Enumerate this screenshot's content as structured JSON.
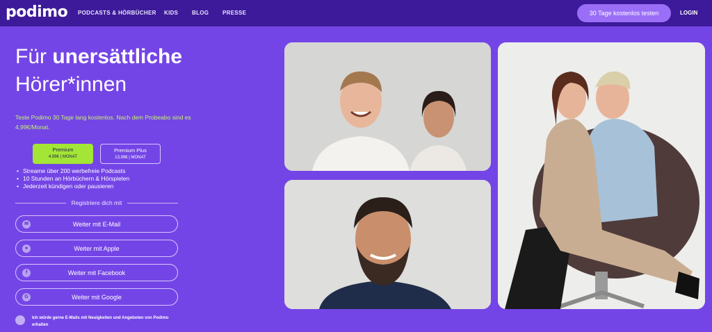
{
  "header": {
    "logo": "podimo",
    "nav": [
      "PODCASTS & HÖRBÜCHER",
      "KIDS",
      "BLOG",
      "PRESSE"
    ],
    "cta": "30 Tage kostenlos testen",
    "login": "LOGIN"
  },
  "hero": {
    "title_pre": "Für",
    "title_bold": "unersättliche",
    "title_line2": "Hörer*innen",
    "trial_text": "Teste Podimo 30 Tage lang kostenlos. Nach dem Probeabo sind es 4,99€/Monat."
  },
  "plans": [
    {
      "name": "Premium",
      "price": "4,99€ | MONAT",
      "selected": true
    },
    {
      "name": "Premium Plus",
      "price": "13,99€ | MONAT",
      "selected": false
    }
  ],
  "features": [
    "Streame über 200 werbefreie Podcasts",
    "10 Stunden an Hörbüchern & Hörspielen",
    "Jederzeit kündigen oder pausieren"
  ],
  "register": {
    "label": "Registriere dich mit",
    "buttons": [
      {
        "label": "Weiter mit E-Mail",
        "icon": "mail-icon"
      },
      {
        "label": "Weiter mit Apple",
        "icon": "apple-icon"
      },
      {
        "label": "Weiter mit Facebook",
        "icon": "facebook-icon"
      },
      {
        "label": "Weiter mit Google",
        "icon": "google-icon"
      }
    ]
  },
  "newsletter": "Ich würde gerne E-Mails mit Neuigkeiten und Angeboten von Podimo erhalten",
  "colors": {
    "background": "#7445e6",
    "header": "#3d1a99",
    "accent_green": "#a3e635",
    "cta": "#9a6ef7"
  }
}
